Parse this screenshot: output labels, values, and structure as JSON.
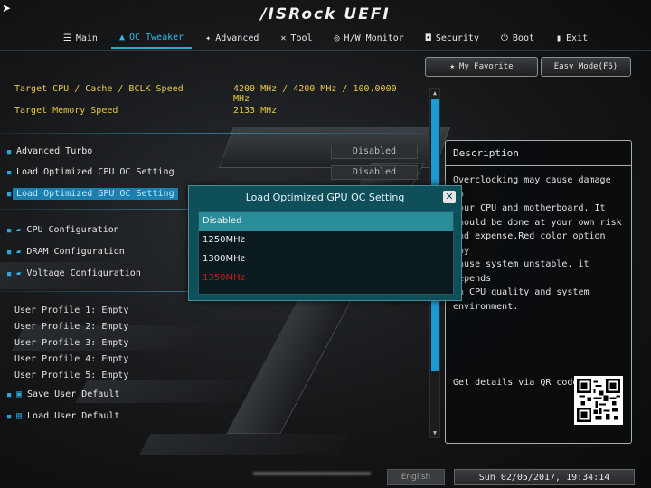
{
  "brand": "/ISRock UEFI",
  "tabs": [
    {
      "label": "Main",
      "icon": "list-icon"
    },
    {
      "label": "OC Tweaker",
      "icon": "rocket-icon"
    },
    {
      "label": "Advanced",
      "icon": "star-icon"
    },
    {
      "label": "Tool",
      "icon": "tool-icon"
    },
    {
      "label": "H/W Monitor",
      "icon": "monitor-icon"
    },
    {
      "label": "Security",
      "icon": "shield-icon"
    },
    {
      "label": "Boot",
      "icon": "power-icon"
    },
    {
      "label": "Exit",
      "icon": "exit-icon"
    }
  ],
  "top_buttons": {
    "favorite": "My Favorite",
    "easy_mode": "Easy Mode(F6)"
  },
  "info": [
    {
      "label": "Target CPU / Cache / BCLK Speed",
      "value": "4200 MHz / 4200 MHz / 100.0000 MHz"
    },
    {
      "label": "Target Memory Speed",
      "value": "2133 MHz"
    }
  ],
  "settings": [
    {
      "label": "Advanced Turbo",
      "value": "Disabled"
    },
    {
      "label": "Load Optimized CPU OC Setting",
      "value": "Disabled"
    },
    {
      "label": "Load Optimized GPU OC Setting",
      "value": ""
    }
  ],
  "submenus": [
    "CPU Configuration",
    "DRAM Configuration",
    "Voltage Configuration"
  ],
  "profiles": [
    "User Profile 1: Empty",
    "User Profile 2: Empty",
    "User Profile 3: Empty",
    "User Profile 4: Empty",
    "User Profile 5: Empty"
  ],
  "profile_actions": [
    "Save User Default",
    "Load User Default"
  ],
  "description": {
    "title": "Description",
    "lines": [
      "Overclocking may cause damage to",
      "your CPU and motherboard. It",
      "should be done at your own risk",
      "and expense.Red color option may",
      "cause system unstable. it depends",
      "on CPU quality and system",
      "environment."
    ],
    "qr_label": "Get details via QR code"
  },
  "modal": {
    "title": "Load Optimized GPU OC Setting",
    "options": [
      "Disabled",
      "1250MHz",
      "1300MHz",
      "1350MHz"
    ],
    "selected": "Disabled",
    "warning_option": "1350MHz"
  },
  "bottom": {
    "language": "English",
    "datetime": "Sun 02/05/2017, 19:34:14"
  },
  "colors": {
    "accent": "#2aa6d8",
    "info_text": "#e9c948",
    "warning": "#d21a1a",
    "modal_bg": "#0f4f5a"
  }
}
